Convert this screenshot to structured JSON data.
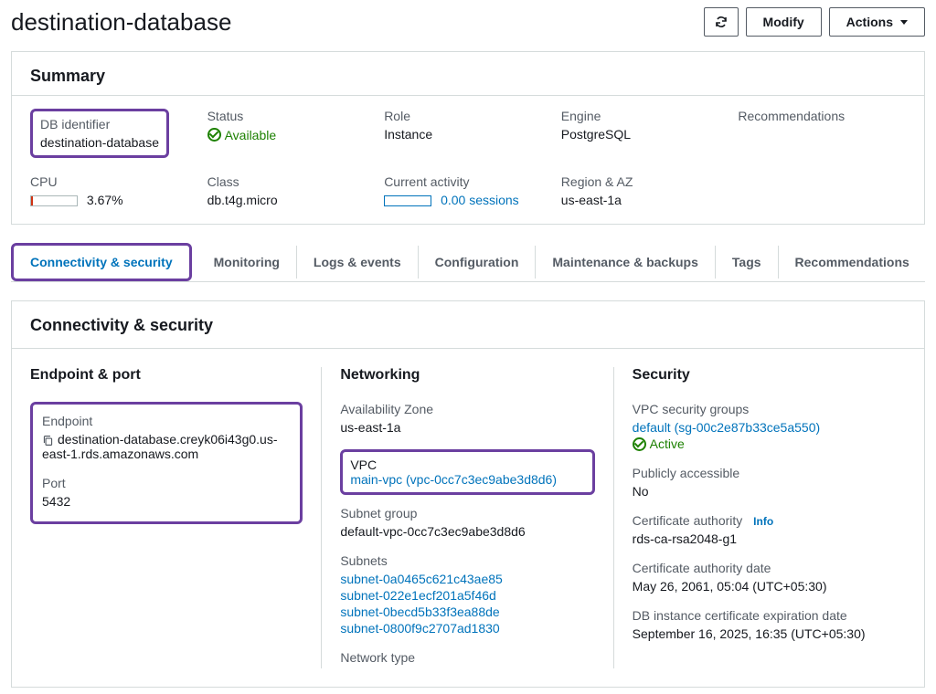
{
  "header": {
    "title": "destination-database",
    "modify_label": "Modify",
    "actions_label": "Actions"
  },
  "summary": {
    "title": "Summary",
    "db_identifier_label": "DB identifier",
    "db_identifier_value": "destination-database",
    "status_label": "Status",
    "status_value": "Available",
    "role_label": "Role",
    "role_value": "Instance",
    "engine_label": "Engine",
    "engine_value": "PostgreSQL",
    "recommendations_label": "Recommendations",
    "cpu_label": "CPU",
    "cpu_value": "3.67%",
    "class_label": "Class",
    "class_value": "db.t4g.micro",
    "current_activity_label": "Current activity",
    "current_activity_value": "0.00 sessions",
    "region_az_label": "Region & AZ",
    "region_az_value": "us-east-1a"
  },
  "tabs": [
    "Connectivity & security",
    "Monitoring",
    "Logs & events",
    "Configuration",
    "Maintenance & backups",
    "Tags",
    "Recommendations"
  ],
  "conn_sec": {
    "panel_title": "Connectivity & security",
    "endpoint_port_title": "Endpoint & port",
    "endpoint_label": "Endpoint",
    "endpoint_value": "destination-database.creyk06i43g0.us-east-1.rds.amazonaws.com",
    "port_label": "Port",
    "port_value": "5432",
    "networking_title": "Networking",
    "az_label": "Availability Zone",
    "az_value": "us-east-1a",
    "vpc_label": "VPC",
    "vpc_value": "main-vpc (vpc-0cc7c3ec9abe3d8d6)",
    "subnet_group_label": "Subnet group",
    "subnet_group_value": "default-vpc-0cc7c3ec9abe3d8d6",
    "subnets_label": "Subnets",
    "subnets": [
      "subnet-0a0465c621c43ae85",
      "subnet-022e1ecf201a5f46d",
      "subnet-0becd5b33f3ea88de",
      "subnet-0800f9c2707ad1830"
    ],
    "network_type_label": "Network type",
    "security_title": "Security",
    "vpc_sg_label": "VPC security groups",
    "vpc_sg_value": "default (sg-00c2e87b33ce5a550)",
    "vpc_sg_status": "Active",
    "publicly_accessible_label": "Publicly accessible",
    "publicly_accessible_value": "No",
    "cert_auth_label": "Certificate authority",
    "cert_auth_info": "Info",
    "cert_auth_value": "rds-ca-rsa2048-g1",
    "cert_auth_date_label": "Certificate authority date",
    "cert_auth_date_value": "May 26, 2061, 05:04 (UTC+05:30)",
    "db_cert_exp_label": "DB instance certificate expiration date",
    "db_cert_exp_value": "September 16, 2025, 16:35 (UTC+05:30)"
  }
}
